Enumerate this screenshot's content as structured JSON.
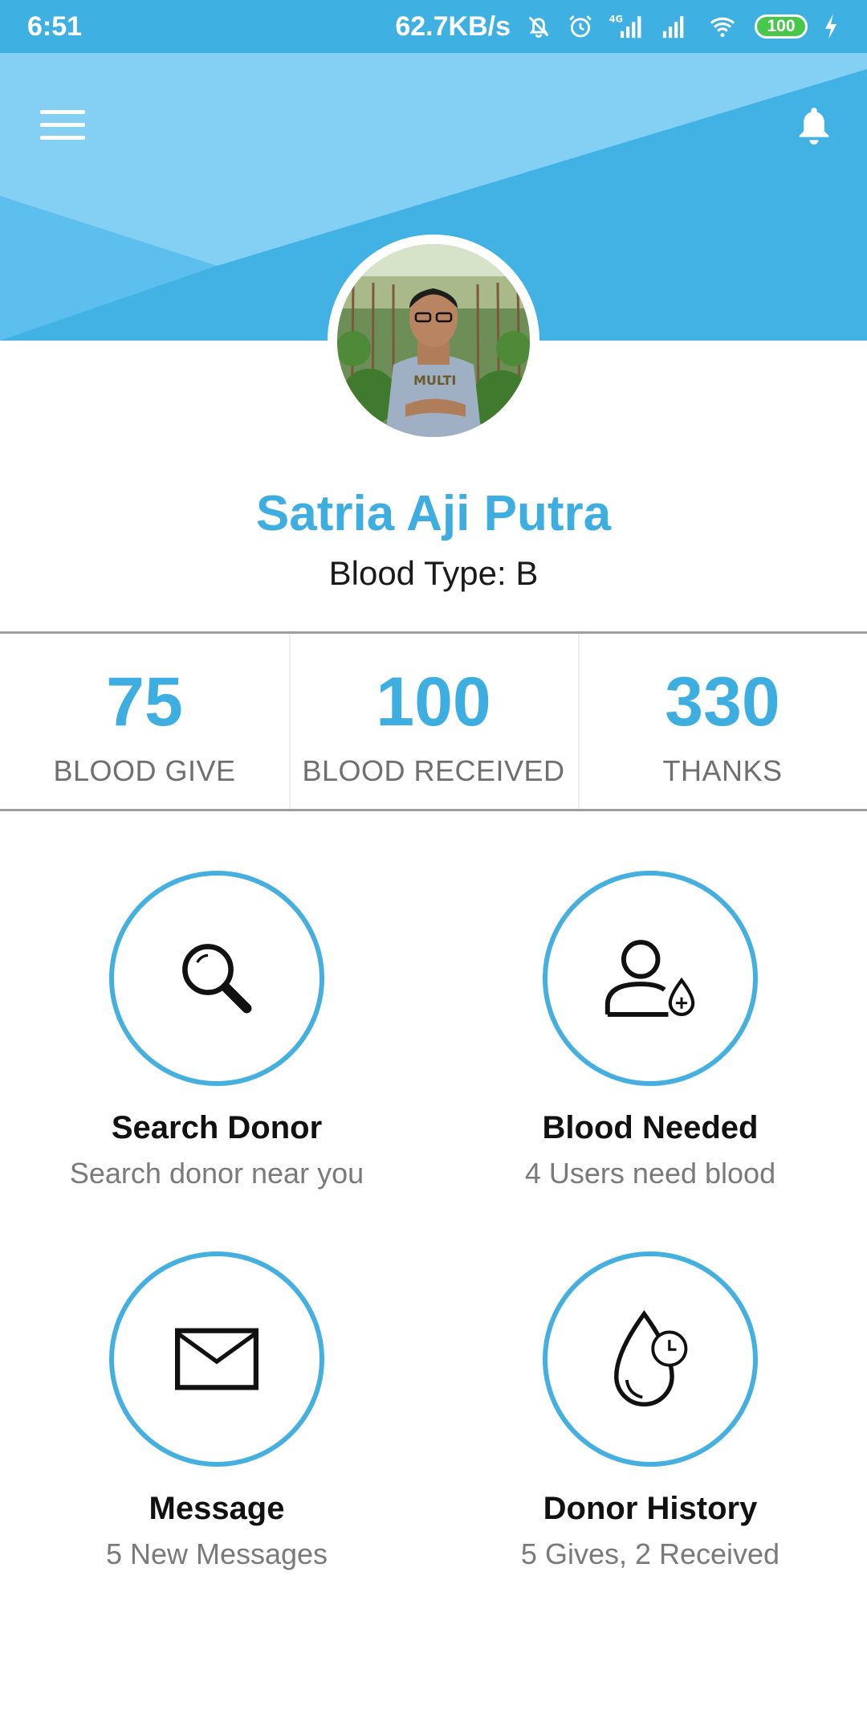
{
  "status_bar": {
    "time": "6:51",
    "network_speed": "62.7KB/s",
    "battery": "100",
    "icons": [
      "mute-bell-icon",
      "alarm-icon",
      "signal-4g-icon",
      "signal-icon",
      "wifi-icon",
      "battery-icon",
      "charging-icon"
    ]
  },
  "header": {
    "menu_icon": "hamburger-menu-icon",
    "notification_icon": "bell-icon",
    "colors": {
      "primary": "#42b2e5",
      "light": "#84d0f5"
    }
  },
  "profile": {
    "name": "Satria Aji Putra",
    "blood_type": "Blood Type: B",
    "avatar": "profile-photo"
  },
  "stats": [
    {
      "value": "75",
      "label": "BLOOD GIVE"
    },
    {
      "value": "100",
      "label": "BLOOD RECEIVED"
    },
    {
      "value": "330",
      "label": "THANKS"
    }
  ],
  "tiles": [
    {
      "title": "Search Donor",
      "subtitle": "Search donor near you",
      "icon": "magnifier-icon"
    },
    {
      "title": "Blood Needed",
      "subtitle": "4 Users need blood",
      "icon": "user-blood-drop-icon"
    },
    {
      "title": "Message",
      "subtitle": "5 New Messages",
      "icon": "envelope-icon"
    },
    {
      "title": "Donor History",
      "subtitle": "5 Gives, 2 Received",
      "icon": "blood-drop-clock-icon"
    }
  ],
  "accent_color": "#3eaee0"
}
